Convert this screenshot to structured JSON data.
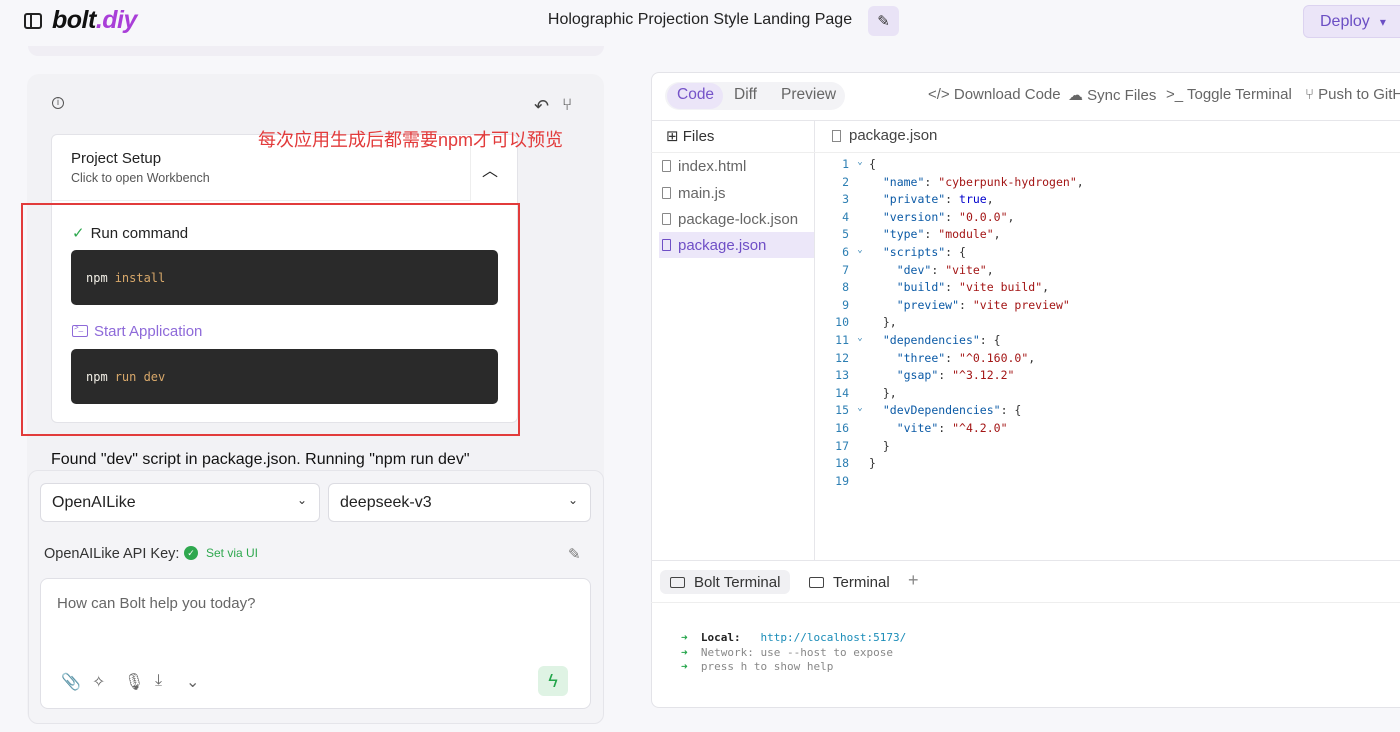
{
  "header": {
    "logo_main": "bolt",
    "logo_suffix": ".diy",
    "project_title": "Holographic Projection Style Landing Page",
    "deploy_label": "Deploy"
  },
  "chat": {
    "setup_title": "Project Setup",
    "setup_subtitle": "Click to open Workbench",
    "annotation": "每次应用生成后都需要npm才可以预览",
    "run_command_label": "Run command",
    "run_command": {
      "cmd": "npm",
      "arg": "install"
    },
    "start_app_label": "Start Application",
    "start_command": {
      "cmd": "npm",
      "arg": "run dev"
    },
    "found_message": "Found \"dev\" script in package.json. Running \"npm run dev\""
  },
  "input": {
    "provider": "OpenAILike",
    "model": "deepseek-v3",
    "api_key_label": "OpenAILike API Key:",
    "api_key_status": "Set via UI",
    "placeholder": "How can Bolt help you today?"
  },
  "workbench": {
    "tabs": [
      "Code",
      "Diff",
      "Preview"
    ],
    "actions": [
      "Download Code",
      "Sync Files",
      "Toggle Terminal",
      "Push to GitHub"
    ],
    "files_label": "Files",
    "files": [
      "index.html",
      "main.js",
      "package-lock.json",
      "package.json"
    ],
    "active_file": "package.json",
    "open_file": "package.json",
    "code_lines": [
      "{",
      "  \"name\": \"cyberpunk-hydrogen\",",
      "  \"private\": true,",
      "  \"version\": \"0.0.0\",",
      "  \"type\": \"module\",",
      "  \"scripts\": {",
      "    \"dev\": \"vite\",",
      "    \"build\": \"vite build\",",
      "    \"preview\": \"vite preview\"",
      "  },",
      "  \"dependencies\": {",
      "    \"three\": \"^0.160.0\",",
      "    \"gsap\": \"^3.12.2\"",
      "  },",
      "  \"devDependencies\": {",
      "    \"vite\": \"^4.2.0\"",
      "  }",
      "}",
      ""
    ],
    "terminal_tabs": [
      "Bolt Terminal",
      "Terminal"
    ],
    "terminal_lines": [
      {
        "label": "Local:",
        "value": "http://localhost:5173/"
      },
      {
        "label": "Network:",
        "value": "use --host to expose"
      },
      {
        "label": "press h",
        "value": "to show help"
      }
    ]
  },
  "colors": {
    "accent": "#7553c8",
    "logo_accent": "#a93ed8",
    "annotation": "#e23b3b",
    "success": "#2fa84f"
  }
}
